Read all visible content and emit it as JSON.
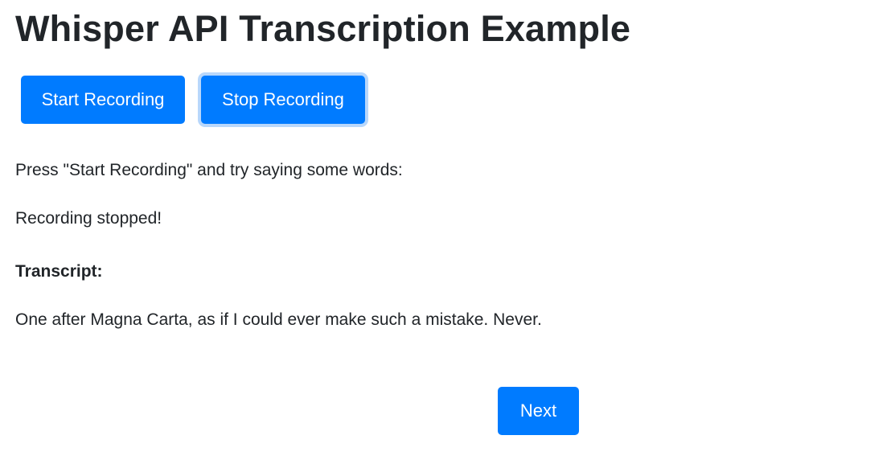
{
  "page": {
    "title": "Whisper API Transcription Example"
  },
  "controls": {
    "start_label": "Start Recording",
    "stop_label": "Stop Recording"
  },
  "instructions": "Press \"Start Recording\" and try saying some words:",
  "status": "Recording stopped!",
  "transcript": {
    "heading": "Transcript:",
    "text": "One after Magna Carta, as if I could ever make such a mistake. Never."
  },
  "navigation": {
    "next_label": "Next"
  },
  "colors": {
    "button_bg": "#007bff",
    "button_text": "#ffffff",
    "focus_ring": "#b8d7fb",
    "body_text": "#212529"
  }
}
